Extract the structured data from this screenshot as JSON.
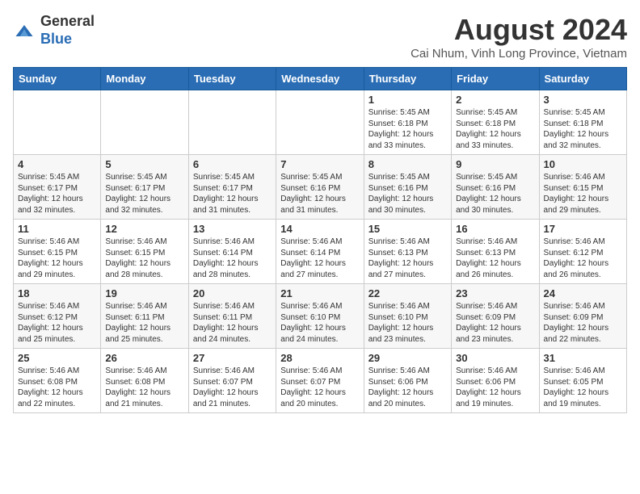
{
  "header": {
    "logo_general": "General",
    "logo_blue": "Blue",
    "month_year": "August 2024",
    "location": "Cai Nhum, Vinh Long Province, Vietnam"
  },
  "days_of_week": [
    "Sunday",
    "Monday",
    "Tuesday",
    "Wednesday",
    "Thursday",
    "Friday",
    "Saturday"
  ],
  "weeks": [
    [
      {
        "day": "",
        "content": ""
      },
      {
        "day": "",
        "content": ""
      },
      {
        "day": "",
        "content": ""
      },
      {
        "day": "",
        "content": ""
      },
      {
        "day": "1",
        "content": "Sunrise: 5:45 AM\nSunset: 6:18 PM\nDaylight: 12 hours\nand 33 minutes."
      },
      {
        "day": "2",
        "content": "Sunrise: 5:45 AM\nSunset: 6:18 PM\nDaylight: 12 hours\nand 33 minutes."
      },
      {
        "day": "3",
        "content": "Sunrise: 5:45 AM\nSunset: 6:18 PM\nDaylight: 12 hours\nand 32 minutes."
      }
    ],
    [
      {
        "day": "4",
        "content": "Sunrise: 5:45 AM\nSunset: 6:17 PM\nDaylight: 12 hours\nand 32 minutes."
      },
      {
        "day": "5",
        "content": "Sunrise: 5:45 AM\nSunset: 6:17 PM\nDaylight: 12 hours\nand 32 minutes."
      },
      {
        "day": "6",
        "content": "Sunrise: 5:45 AM\nSunset: 6:17 PM\nDaylight: 12 hours\nand 31 minutes."
      },
      {
        "day": "7",
        "content": "Sunrise: 5:45 AM\nSunset: 6:16 PM\nDaylight: 12 hours\nand 31 minutes."
      },
      {
        "day": "8",
        "content": "Sunrise: 5:45 AM\nSunset: 6:16 PM\nDaylight: 12 hours\nand 30 minutes."
      },
      {
        "day": "9",
        "content": "Sunrise: 5:45 AM\nSunset: 6:16 PM\nDaylight: 12 hours\nand 30 minutes."
      },
      {
        "day": "10",
        "content": "Sunrise: 5:46 AM\nSunset: 6:15 PM\nDaylight: 12 hours\nand 29 minutes."
      }
    ],
    [
      {
        "day": "11",
        "content": "Sunrise: 5:46 AM\nSunset: 6:15 PM\nDaylight: 12 hours\nand 29 minutes."
      },
      {
        "day": "12",
        "content": "Sunrise: 5:46 AM\nSunset: 6:15 PM\nDaylight: 12 hours\nand 28 minutes."
      },
      {
        "day": "13",
        "content": "Sunrise: 5:46 AM\nSunset: 6:14 PM\nDaylight: 12 hours\nand 28 minutes."
      },
      {
        "day": "14",
        "content": "Sunrise: 5:46 AM\nSunset: 6:14 PM\nDaylight: 12 hours\nand 27 minutes."
      },
      {
        "day": "15",
        "content": "Sunrise: 5:46 AM\nSunset: 6:13 PM\nDaylight: 12 hours\nand 27 minutes."
      },
      {
        "day": "16",
        "content": "Sunrise: 5:46 AM\nSunset: 6:13 PM\nDaylight: 12 hours\nand 26 minutes."
      },
      {
        "day": "17",
        "content": "Sunrise: 5:46 AM\nSunset: 6:12 PM\nDaylight: 12 hours\nand 26 minutes."
      }
    ],
    [
      {
        "day": "18",
        "content": "Sunrise: 5:46 AM\nSunset: 6:12 PM\nDaylight: 12 hours\nand 25 minutes."
      },
      {
        "day": "19",
        "content": "Sunrise: 5:46 AM\nSunset: 6:11 PM\nDaylight: 12 hours\nand 25 minutes."
      },
      {
        "day": "20",
        "content": "Sunrise: 5:46 AM\nSunset: 6:11 PM\nDaylight: 12 hours\nand 24 minutes."
      },
      {
        "day": "21",
        "content": "Sunrise: 5:46 AM\nSunset: 6:10 PM\nDaylight: 12 hours\nand 24 minutes."
      },
      {
        "day": "22",
        "content": "Sunrise: 5:46 AM\nSunset: 6:10 PM\nDaylight: 12 hours\nand 23 minutes."
      },
      {
        "day": "23",
        "content": "Sunrise: 5:46 AM\nSunset: 6:09 PM\nDaylight: 12 hours\nand 23 minutes."
      },
      {
        "day": "24",
        "content": "Sunrise: 5:46 AM\nSunset: 6:09 PM\nDaylight: 12 hours\nand 22 minutes."
      }
    ],
    [
      {
        "day": "25",
        "content": "Sunrise: 5:46 AM\nSunset: 6:08 PM\nDaylight: 12 hours\nand 22 minutes."
      },
      {
        "day": "26",
        "content": "Sunrise: 5:46 AM\nSunset: 6:08 PM\nDaylight: 12 hours\nand 21 minutes."
      },
      {
        "day": "27",
        "content": "Sunrise: 5:46 AM\nSunset: 6:07 PM\nDaylight: 12 hours\nand 21 minutes."
      },
      {
        "day": "28",
        "content": "Sunrise: 5:46 AM\nSunset: 6:07 PM\nDaylight: 12 hours\nand 20 minutes."
      },
      {
        "day": "29",
        "content": "Sunrise: 5:46 AM\nSunset: 6:06 PM\nDaylight: 12 hours\nand 20 minutes."
      },
      {
        "day": "30",
        "content": "Sunrise: 5:46 AM\nSunset: 6:06 PM\nDaylight: 12 hours\nand 19 minutes."
      },
      {
        "day": "31",
        "content": "Sunrise: 5:46 AM\nSunset: 6:05 PM\nDaylight: 12 hours\nand 19 minutes."
      }
    ]
  ]
}
